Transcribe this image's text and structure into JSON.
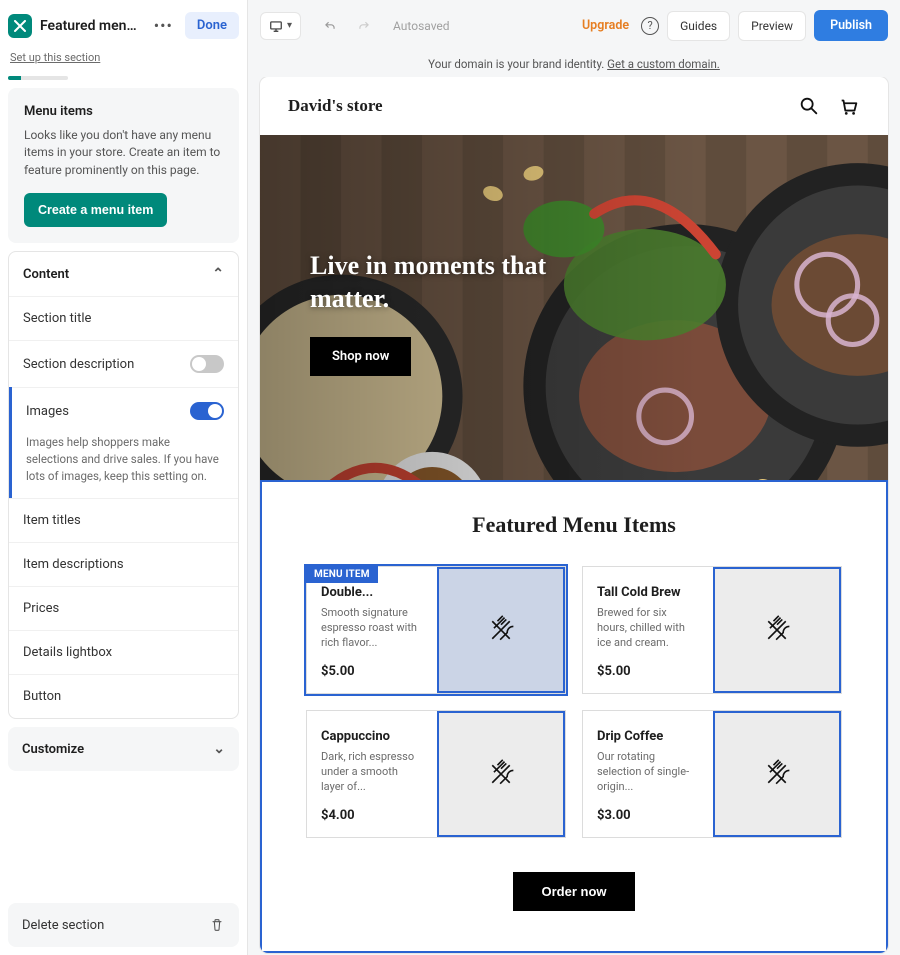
{
  "sidebar": {
    "title": "Featured menu it...",
    "done_label": "Done",
    "setup_label": "Set up this section",
    "menu_items_panel": {
      "heading": "Menu items",
      "body": "Looks like you don't have any menu items in your store. Create an item to feature prominently on this page.",
      "create_btn": "Create a menu item"
    },
    "content": {
      "heading": "Content",
      "rows": {
        "section_title": "Section title",
        "section_description": "Section description",
        "images": "Images",
        "images_help": "Images help shoppers make selections and drive sales. If you have lots of images, keep this setting on.",
        "item_titles": "Item titles",
        "item_descriptions": "Item descriptions",
        "prices": "Prices",
        "details_lightbox": "Details lightbox",
        "button": "Button"
      }
    },
    "customize_label": "Customize",
    "delete_label": "Delete section"
  },
  "topbar": {
    "autosaved": "Autosaved",
    "upgrade": "Upgrade",
    "guides": "Guides",
    "preview": "Preview",
    "publish": "Publish"
  },
  "banner": {
    "text": "Your domain is your brand identity. ",
    "link": "Get a custom domain."
  },
  "site": {
    "title": "David's store",
    "hero_title_line1": "Live in moments that",
    "hero_title_line2": "matter.",
    "shop_btn": "Shop now",
    "featured_heading": "Featured Menu Items",
    "order_btn": "Order now",
    "menu_tag": "MENU ITEM",
    "items": [
      {
        "title": "Double...",
        "desc": "Smooth signature espresso roast with rich flavor...",
        "price": "$5.00"
      },
      {
        "title": "Tall Cold Brew",
        "desc": "Brewed for six hours, chilled with ice and cream.",
        "price": "$5.00"
      },
      {
        "title": "Cappuccino",
        "desc": "Dark, rich espresso under a smooth layer of...",
        "price": "$4.00"
      },
      {
        "title": "Drip Coffee",
        "desc": "Our rotating selection of single-origin...",
        "price": "$3.00"
      }
    ]
  }
}
